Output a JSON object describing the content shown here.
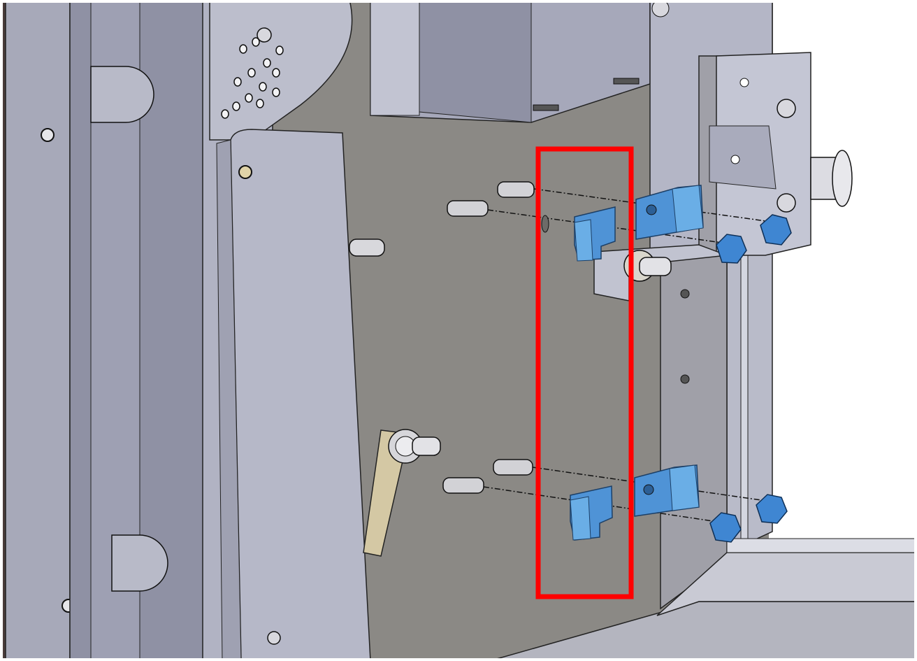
{
  "colors": {
    "background_panel": "#8c8a85",
    "sheet_metal": "#b4b6c6",
    "sheet_metal_shadow": "#8f91a3",
    "frame_dark": "#4a3c3a",
    "clip_blue": "#4f93d6",
    "clip_blue_dark": "#2f6fb4",
    "nut_blue": "#3f86d2",
    "pin_grey": "#cfcfcf",
    "highlight_red": "#ff0000",
    "outline": "#111111"
  },
  "highlight_box": {
    "shape": "rectangle",
    "color": "#ff0000"
  },
  "parts": {
    "mounting_clips_upper": {
      "name": "clip-pair-upper"
    },
    "mounting_clips_lower": {
      "name": "clip-pair-lower"
    }
  }
}
